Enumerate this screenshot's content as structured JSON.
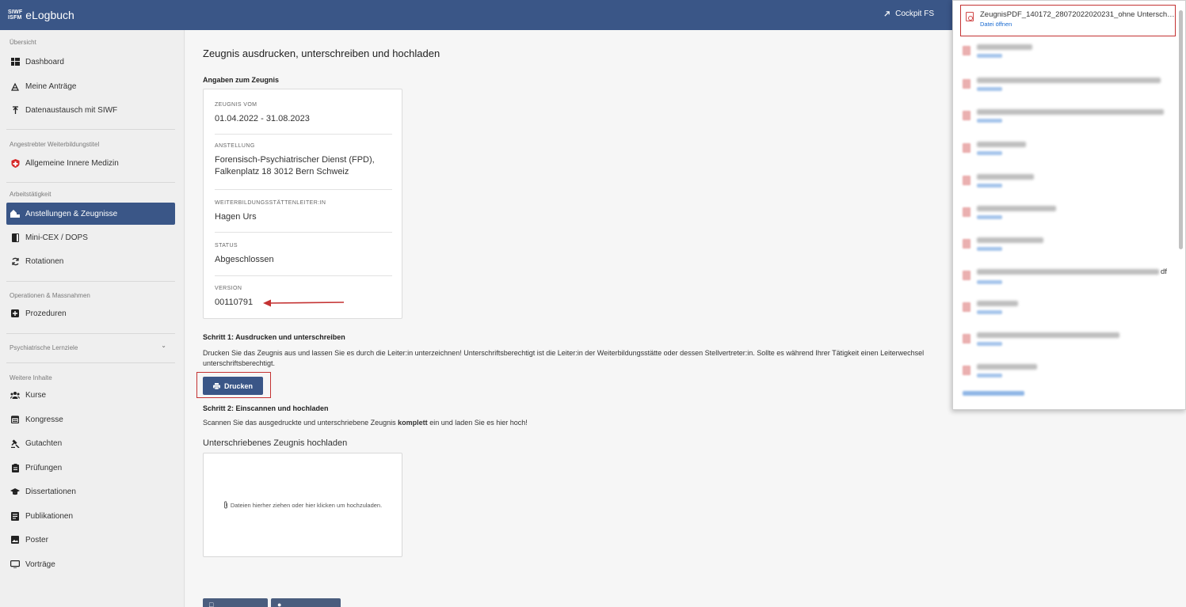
{
  "app": {
    "logo_top": "SIWF",
    "logo_bottom": "ISFM",
    "name": "eLogbuch",
    "cockpit": "Cockpit FS"
  },
  "sidebar": {
    "groups": [
      "Übersicht",
      "Angestrebter Weiterbildungstitel",
      "Arbeitstätigkeit",
      "Operationen & Massnahmen",
      "Psychiatrische Lernziele",
      "Weitere Inhalte"
    ],
    "items": [
      {
        "label": "Dashboard",
        "icon": "dashboard-icon"
      },
      {
        "label": "Meine Anträge",
        "icon": "requests-icon"
      },
      {
        "label": "Datenaustausch mit SIWF",
        "icon": "data-exchange-icon"
      },
      {
        "label": "Allgemeine Innere Medizin",
        "icon": "swiss-cross-icon"
      },
      {
        "label": "Anstellungen & Zeugnisse",
        "icon": "employment-icon"
      },
      {
        "label": "Mini-CEX / DOPS",
        "icon": "book-icon"
      },
      {
        "label": "Rotationen",
        "icon": "rotation-icon"
      },
      {
        "label": "Prozeduren",
        "icon": "plus-square-icon"
      },
      {
        "label": "Kurse",
        "icon": "users-icon"
      },
      {
        "label": "Kongresse",
        "icon": "calendar-icon"
      },
      {
        "label": "Gutachten",
        "icon": "gavel-icon"
      },
      {
        "label": "Prüfungen",
        "icon": "clipboard-icon"
      },
      {
        "label": "Dissertationen",
        "icon": "graduation-cap-icon"
      },
      {
        "label": "Publikationen",
        "icon": "publication-icon"
      },
      {
        "label": "Poster",
        "icon": "image-icon"
      },
      {
        "label": "Vorträge",
        "icon": "presentation-icon"
      }
    ]
  },
  "main": {
    "title": "Zeugnis ausdrucken, unterschreiben und hochladen",
    "details_title": "Angaben zum Zeugnis",
    "fields": [
      {
        "label": "ZEUGNIS VOM",
        "value": "01.04.2022 - 31.08.2023"
      },
      {
        "label": "ANSTELLUNG",
        "value_line1": "Forensisch-Psychiatrischer Dienst (FPD),",
        "value_line2": "Falkenplatz 18 3012 Bern Schweiz"
      },
      {
        "label": "WEITERBILDUNGSSTÄTTENLEITER:IN",
        "value": "Hagen Urs"
      },
      {
        "label": "STATUS",
        "value": "Abgeschlossen"
      },
      {
        "label": "VERSION",
        "value": "00110791"
      }
    ],
    "step1_title": "Schritt 1: Ausdrucken und unterschreiben",
    "step1_text": "Drucken Sie das Zeugnis aus und lassen Sie es durch die Leiter:in unterzeichnen! Unterschriftsberechtigt ist die Leiter:in der Weiterbildungsstätte oder dessen Stellvertreter:in. Sollte es während Ihrer Tätigkeit einen Leiterwechsel",
    "step1_text2": "unterschriftsberechtigt.",
    "print_button": "Drucken",
    "step2_title": "Schritt 2: Einscannen und hochladen",
    "step2_text_before": "Scannen Sie das ausgedruckte und unterschriebene Zeugnis ",
    "step2_text_bold": "komplett",
    "step2_text_after": " ein und laden Sie es hier hoch!",
    "upload_label": "Unterschriebenes Zeugnis hochladen",
    "dropzone_text": "Dateien hierher ziehen oder hier klicken um hochzuladen."
  },
  "downloads": {
    "first_file": "ZeugnisPDF_140172_28072022020231_ohne Untersch…",
    "first_action": "Datei öffnen",
    "partial_suffix": "df"
  },
  "colors": {
    "brand": "#3a5687",
    "highlight": "#c43232",
    "link": "#1a6bd1"
  }
}
